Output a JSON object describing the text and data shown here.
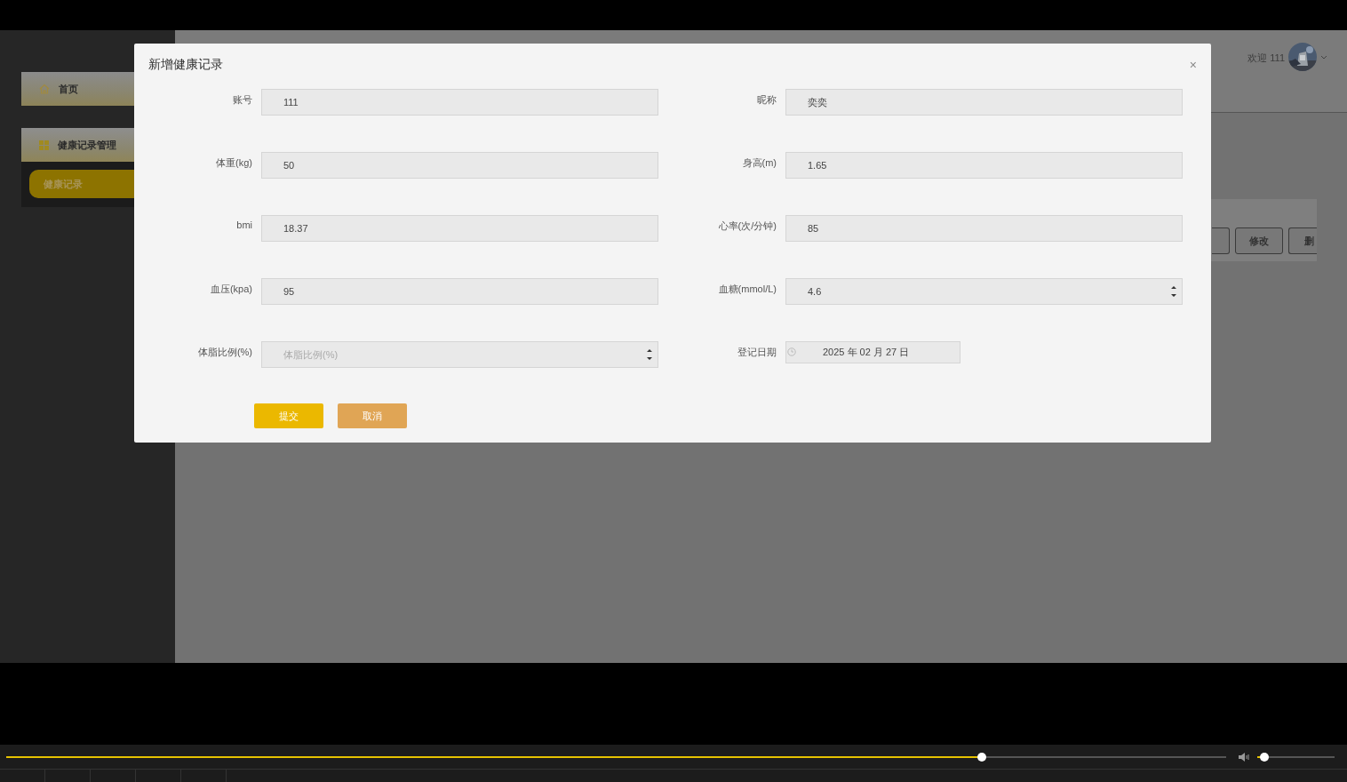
{
  "sidebar": {
    "items": [
      {
        "label": "首页",
        "kind": "link"
      },
      {
        "label": "健康记录管理",
        "kind": "group",
        "expanded": true,
        "children": [
          {
            "label": "健康记录",
            "selected": true
          }
        ]
      }
    ]
  },
  "header": {
    "welcome": "欢迎 111"
  },
  "background_card": {
    "buttons": [
      {
        "kind": "covered"
      },
      {
        "kind": "button",
        "label": "修改"
      },
      {
        "kind": "button",
        "label": "删"
      }
    ]
  },
  "dialog": {
    "title": "新增健康记录",
    "close": "×",
    "fields": [
      {
        "label": "账号",
        "kind": "text",
        "value": "111"
      },
      {
        "label": "昵称",
        "kind": "text",
        "value": "奕奕"
      },
      {
        "label": "体重(kg)",
        "kind": "text",
        "value": "50"
      },
      {
        "label": "身高(m)",
        "kind": "text",
        "value": "1.65"
      },
      {
        "label": "bmi",
        "kind": "text",
        "value": "18.37"
      },
      {
        "label": "心率(次/分钟)",
        "kind": "text",
        "value": "85"
      },
      {
        "label": "血压(kpa)",
        "kind": "text",
        "value": "95"
      },
      {
        "label": "血糖(mmol/L)",
        "kind": "number",
        "value": "4.6"
      },
      {
        "label": "体脂比例(%)",
        "kind": "number",
        "placeholder": "体脂比例(%)"
      },
      {
        "label": "登记日期",
        "kind": "date",
        "value": "2025 年 02 月 27 日"
      }
    ],
    "buttons": [
      {
        "label": "提交",
        "kind": "primary"
      },
      {
        "label": "取消",
        "kind": "secondary"
      }
    ]
  },
  "player": {
    "progress": {
      "level": 0.8
    },
    "volume": {
      "level": 0.09
    }
  }
}
